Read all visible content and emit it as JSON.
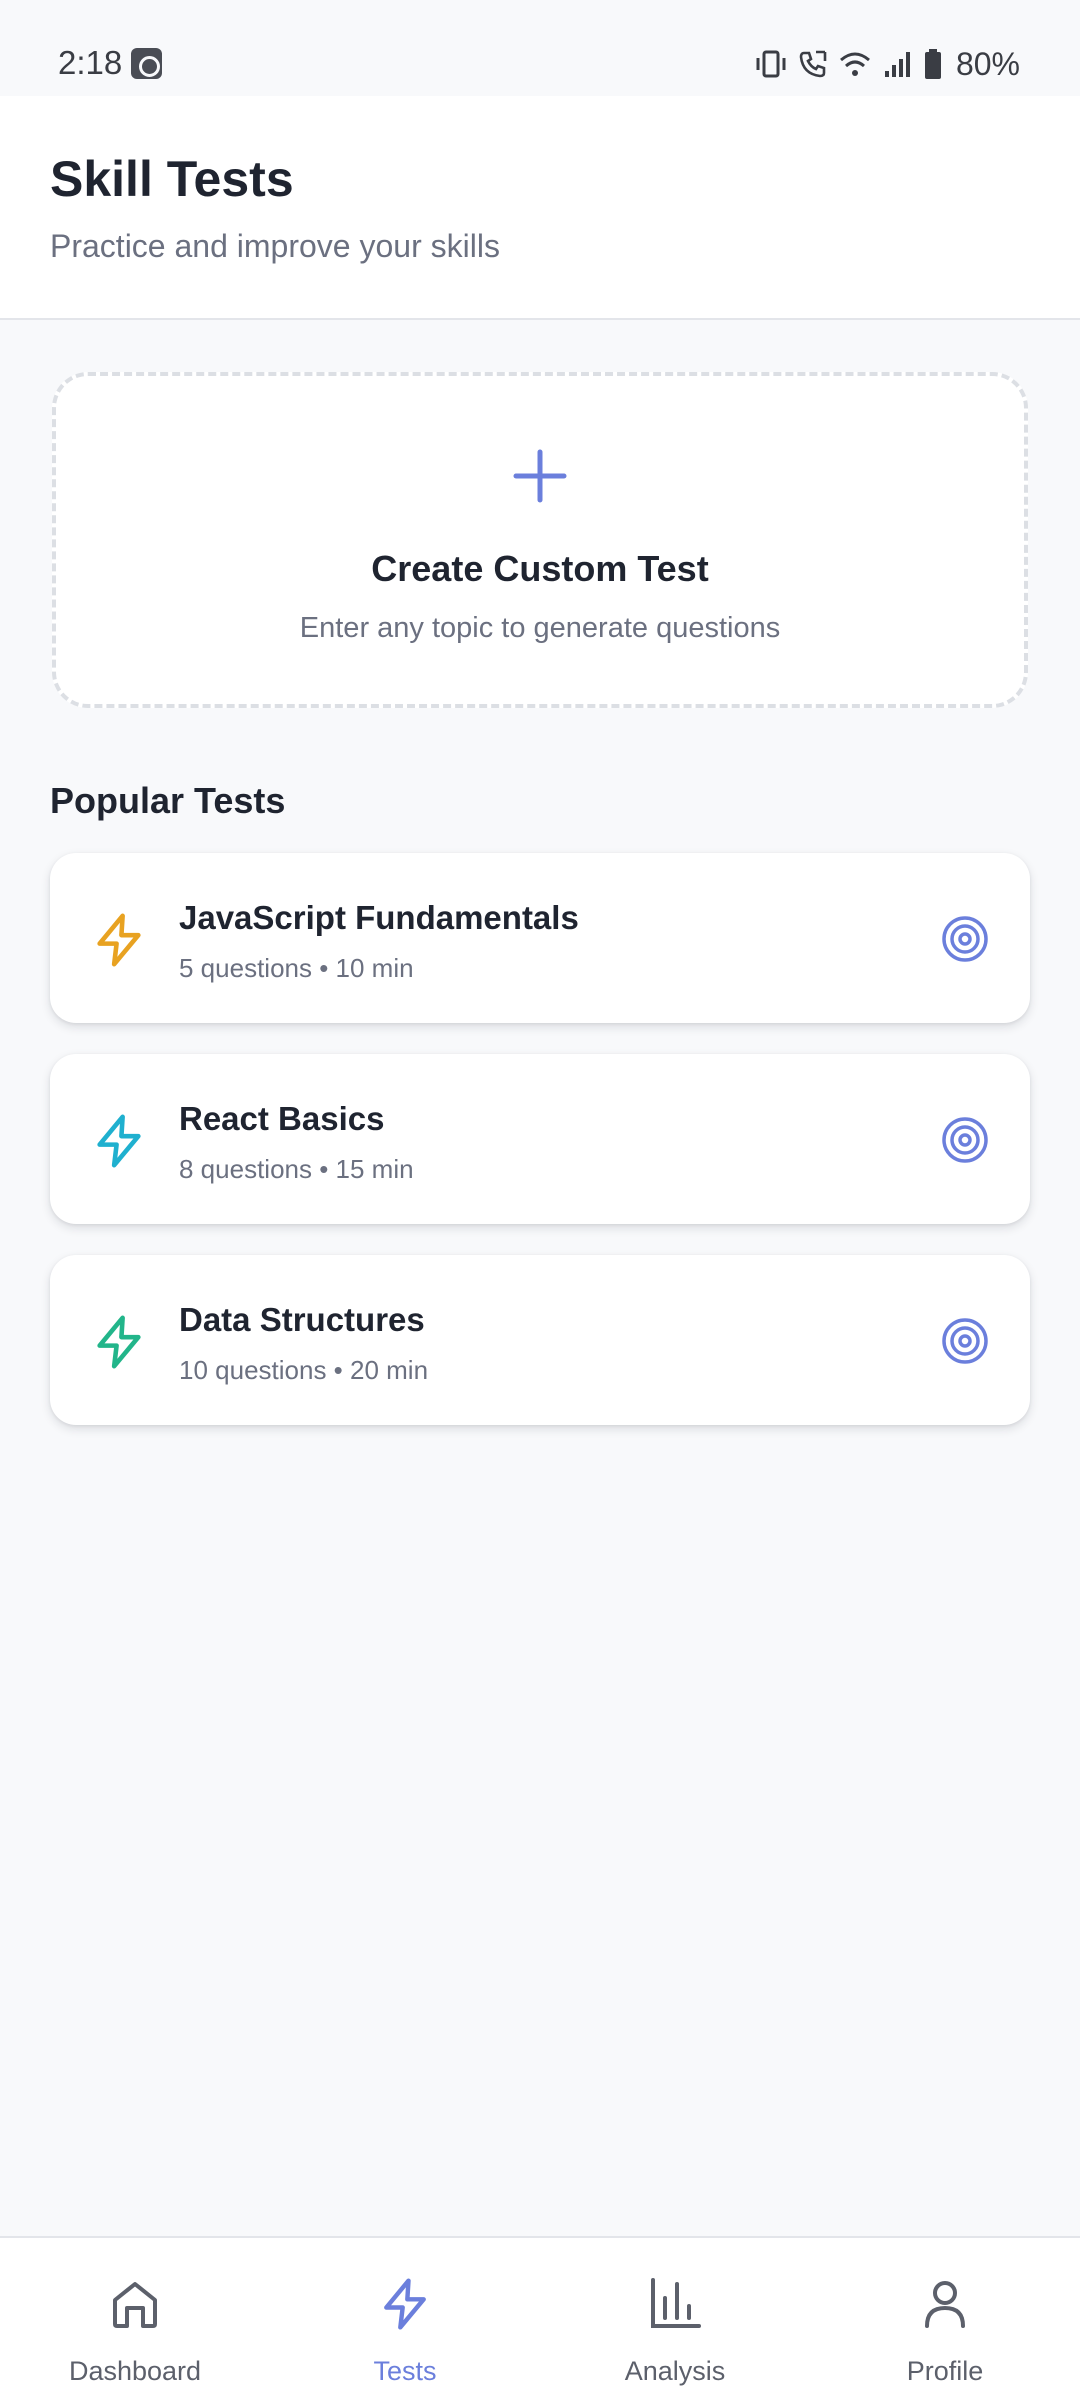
{
  "status_bar": {
    "time": "2:18",
    "battery": "80%"
  },
  "header": {
    "title": "Skill Tests",
    "subtitle": "Practice and improve your skills"
  },
  "custom_test": {
    "icon": "plus-icon",
    "title": "Create Custom Test",
    "subtitle": "Enter any topic to generate questions"
  },
  "popular": {
    "section_title": "Popular Tests",
    "tests": [
      {
        "name": "JavaScript Fundamentals",
        "meta": "5 questions • 10 min",
        "icon": "lightning-icon",
        "icon_color": "#e8a221"
      },
      {
        "name": "React Basics",
        "meta": "8 questions • 15 min",
        "icon": "lightning-icon",
        "icon_color": "#1fb0cf"
      },
      {
        "name": "Data Structures",
        "meta": "10 questions • 20 min",
        "icon": "lightning-icon",
        "icon_color": "#22b58a"
      }
    ]
  },
  "bottom_nav": {
    "items": [
      {
        "label": "Dashboard",
        "icon": "home-icon",
        "active": false
      },
      {
        "label": "Tests",
        "icon": "lightning-icon",
        "active": true
      },
      {
        "label": "Analysis",
        "icon": "bar-chart-icon",
        "active": false
      },
      {
        "label": "Profile",
        "icon": "person-icon",
        "active": false
      }
    ]
  },
  "colors": {
    "accent": "#6b7fdc",
    "text_primary": "#1f2430",
    "text_secondary": "#6b7080",
    "background": "#f8f9fb"
  }
}
